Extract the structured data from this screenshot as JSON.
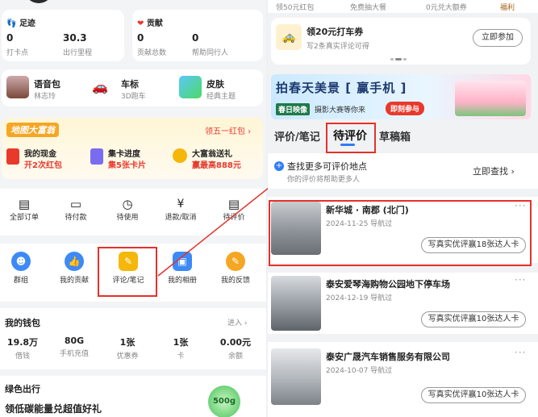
{
  "left": {
    "footprint": {
      "title": "足迹",
      "stats": [
        {
          "value": "0",
          "label": "打卡点"
        },
        {
          "value": "30.3",
          "label": "出行里程"
        }
      ]
    },
    "contribution": {
      "title": "贡献",
      "stats": [
        {
          "value": "0",
          "label": "贡献总数"
        },
        {
          "value": "0",
          "label": "帮助同行人"
        }
      ]
    },
    "personalize": [
      {
        "title": "语音包",
        "sub": "林志玲"
      },
      {
        "title": "车标",
        "sub": "3D跑车"
      },
      {
        "title": "皮肤",
        "sub": "经典主题"
      }
    ],
    "promo": {
      "logo": "地图大富翁",
      "claim": "领五一红包",
      "items": [
        {
          "title": "我的现金",
          "value": "开2次红包"
        },
        {
          "title": "集卡进度",
          "value": "集5张卡片"
        },
        {
          "title": "大富翁送礼",
          "value": "赢最高888元"
        }
      ]
    },
    "orders": [
      "全部订单",
      "待付款",
      "待使用",
      "退款/取消",
      "待评价"
    ],
    "services": [
      "群组",
      "我的贡献",
      "评论/笔记",
      "我的相册",
      "我的反馈"
    ],
    "wallet": {
      "title": "我的钱包",
      "enter": "进入",
      "stats": [
        {
          "value": "19.8万",
          "label": "借钱"
        },
        {
          "value": "80G",
          "label": "手机充值"
        },
        {
          "value": "1张",
          "label": "优惠券"
        },
        {
          "value": "1张",
          "label": "卡"
        },
        {
          "value": "0.00元",
          "label": "余额"
        }
      ]
    },
    "green": {
      "title": "绿色出行",
      "line": "领低碳能量兑超值好礼",
      "badge": "500g"
    }
  },
  "right": {
    "topstrip": [
      "领50元红包",
      "免费抽大餐",
      "0元兑大额券",
      "福利"
    ],
    "taxi": {
      "title": "领20元打车券",
      "sub": "写2条真实评论可得",
      "button": "立即参加"
    },
    "banner": {
      "title": "拍春天美景 [ 赢手机 ]",
      "sub1": "春日映像",
      "sub2": "摄影大赛等你来",
      "button": "即刻参与"
    },
    "tabs": [
      "评价/笔记",
      "待评价",
      "草稿箱"
    ],
    "find": {
      "title": "查找更多可评价地点",
      "sub": "你的评价将帮助更多人",
      "action": "立即查找"
    },
    "items": [
      {
        "name": "新华城 · 南郡 (北门)",
        "meta": "2024-11-25 导航过",
        "button": "写真实优评赢18张达人卡"
      },
      {
        "name": "泰安爱琴海购物公园地下停车场",
        "meta": "2024-12-19 导航过",
        "button": "写真实优评赢10张达人卡"
      },
      {
        "name": "泰安广晟汽车销售服务有限公司",
        "meta": "2024-10-07 导航过",
        "button": "写真实优评赢10张达人卡"
      }
    ]
  }
}
